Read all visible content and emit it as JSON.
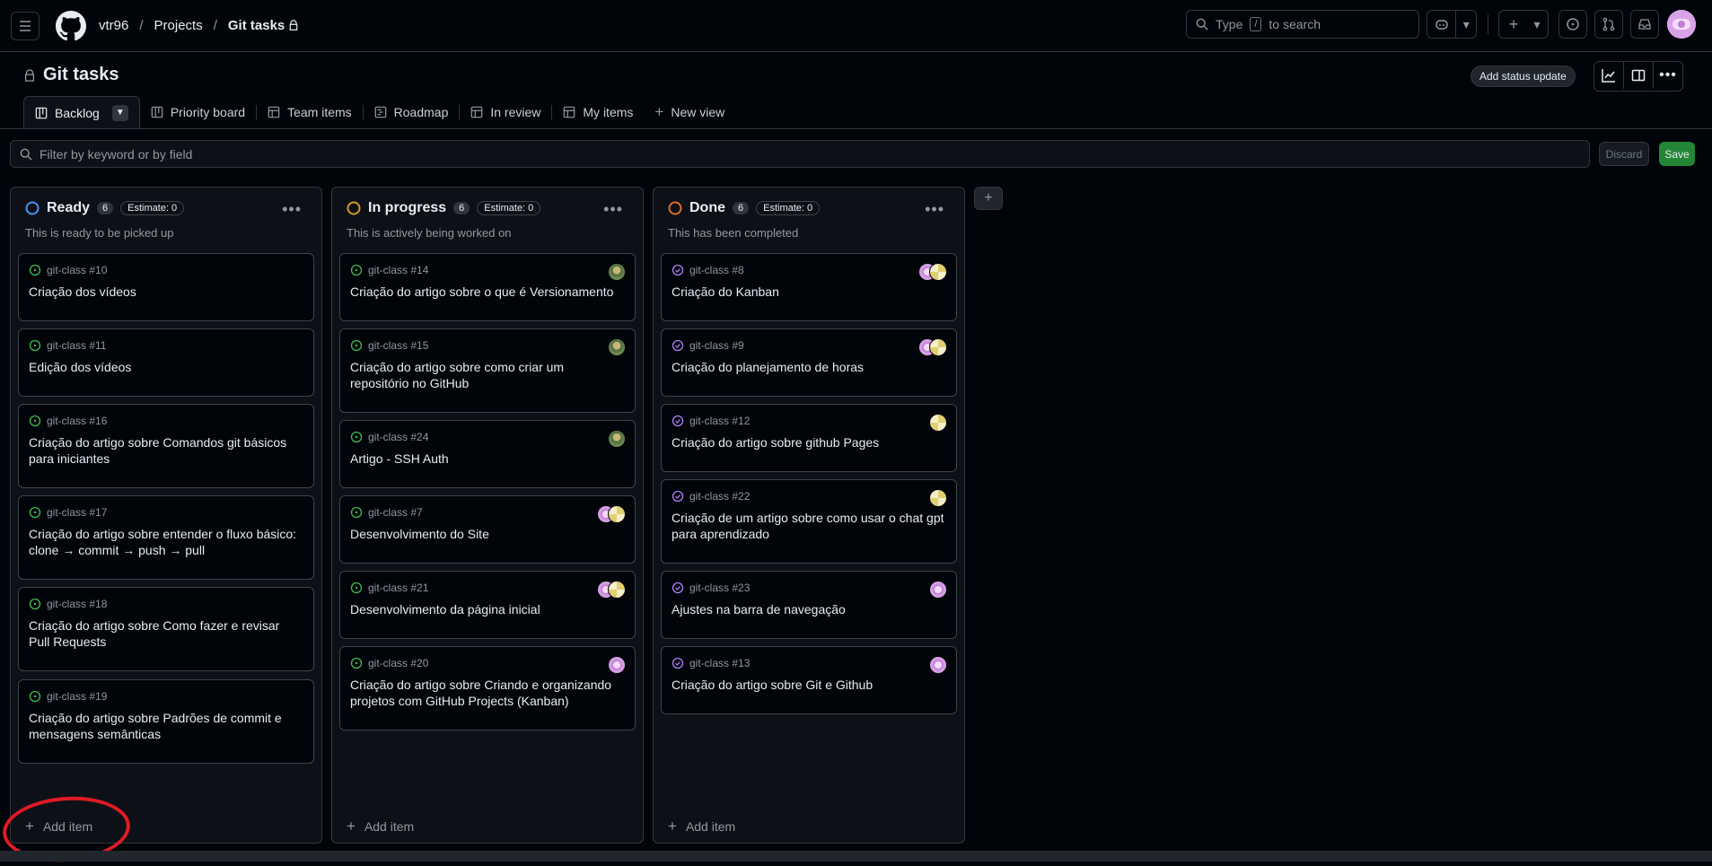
{
  "topbar": {
    "owner": "vtr96",
    "projects": "Projects",
    "project": "Git tasks",
    "search_prefix": "Type",
    "search_key": "/",
    "search_suffix": "to search"
  },
  "project": {
    "title": "Git tasks",
    "status_update": "Add status update"
  },
  "views": [
    {
      "label": "Backlog",
      "icon": "board-icon"
    },
    {
      "label": "Priority board",
      "icon": "board-icon"
    },
    {
      "label": "Team items",
      "icon": "table-icon"
    },
    {
      "label": "Roadmap",
      "icon": "roadmap-icon"
    },
    {
      "label": "In review",
      "icon": "table-icon"
    },
    {
      "label": "My items",
      "icon": "table-icon"
    },
    {
      "label": "New view",
      "icon": "plus-icon"
    }
  ],
  "filter": {
    "placeholder": "Filter by keyword or by field",
    "discard": "Discard",
    "save": "Save"
  },
  "columns": [
    {
      "name": "Ready",
      "count": "6",
      "estimate": "Estimate: 0",
      "description": "This is ready to be picked up",
      "ring_color": "#4493f8",
      "add_item": "Add item",
      "cards": [
        {
          "ref": "git-class #10",
          "title": "Criação dos vídeos"
        },
        {
          "ref": "git-class #11",
          "title": "Edição dos vídeos"
        },
        {
          "ref": "git-class #16",
          "title": "Criação do artigo sobre Comandos git básicos para iniciantes"
        },
        {
          "ref": "git-class #17",
          "title": "Criação do artigo sobre entender o fluxo básico: clone → commit → push → pull"
        },
        {
          "ref": "git-class #18",
          "title": "Criação do artigo sobre Como fazer e revisar Pull Requests"
        },
        {
          "ref": "git-class #19",
          "title": "Criação do artigo sobre Padrões de commit e mensagens semânticas"
        }
      ]
    },
    {
      "name": "In progress",
      "count": "6",
      "estimate": "Estimate: 0",
      "description": "This is actively being worked on",
      "ring_color": "#d29922",
      "add_item": "Add item",
      "cards": [
        {
          "ref": "git-class #14",
          "title": "Criação do artigo sobre o que é Versionamento"
        },
        {
          "ref": "git-class #15",
          "title": "Criação do artigo sobre como criar um repositório no GitHub"
        },
        {
          "ref": "git-class #24",
          "title": "Artigo - SSH Auth"
        },
        {
          "ref": "git-class #7",
          "title": "Desenvolvimento do Site"
        },
        {
          "ref": "git-class #21",
          "title": "Desenvolvimento da página inicial"
        },
        {
          "ref": "git-class #20",
          "title": "Criação do artigo sobre Criando e organizando projetos com GitHub Projects (Kanban)"
        }
      ]
    },
    {
      "name": "Done",
      "count": "6",
      "estimate": "Estimate: 0",
      "description": "This has been completed",
      "ring_color": "#db6d28",
      "add_item": "Add item",
      "cards": [
        {
          "ref": "git-class #8",
          "title": "Criação do Kanban"
        },
        {
          "ref": "git-class #9",
          "title": "Criação do planejamento de horas"
        },
        {
          "ref": "git-class #12",
          "title": "Criação do artigo sobre github Pages"
        },
        {
          "ref": "git-class #22",
          "title": "Criação de um artigo sobre como usar o chat gpt para aprendizado"
        },
        {
          "ref": "git-class #23",
          "title": "Ajustes na barra de navegação"
        },
        {
          "ref": "git-class #13",
          "title": "Criação do artigo sobre Git e Github"
        }
      ]
    }
  ],
  "colors": {
    "open_issue": "#3fb950",
    "closed_issue": "#ab7df8",
    "annotation": "#e01b24"
  }
}
